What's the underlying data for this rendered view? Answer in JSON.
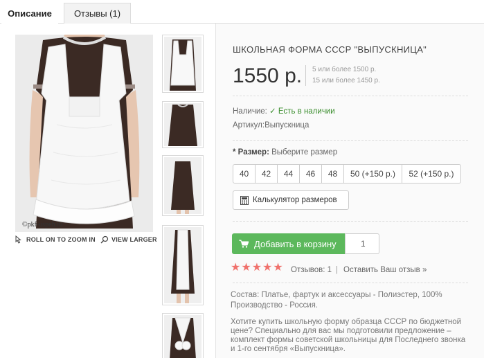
{
  "tabs": [
    {
      "label": "Описание"
    },
    {
      "label": "Отзывы (1)"
    }
  ],
  "gallery": {
    "watermark": "©pkf-uspeh.ru",
    "zoom_hint": "ROLL ON TO ZOOM IN",
    "view_larger": "VIEW LARGER",
    "thumbnail_count": 5
  },
  "product": {
    "title": "ШКОЛЬНАЯ ФОРМА СССР \"ВЫПУСКНИЦА\"",
    "price": "1550 р.",
    "discounts": [
      "5 или более 1500 р.",
      "15 или более 1450 р."
    ],
    "availability_label": "Наличие:",
    "availability_value": "Есть в наличии",
    "sku": "Артикул:Выпускница",
    "size_label": "* Размер:",
    "size_placeholder": "Выберите размер",
    "sizes": [
      "40",
      "42",
      "44",
      "46",
      "48",
      "50 (+150 р.)",
      "52 (+150 р.)"
    ],
    "size_calculator": "Калькулятор размеров",
    "add_to_cart": "Добавить в корзину",
    "quantity": "1",
    "rating": 5,
    "reviews_text": "Отзывов: 1",
    "review_separator": "|",
    "leave_review": "Оставить Ваш отзыв »",
    "composition": "Состав: Платье, фартук и аксессуары - Полиэстер, 100% Производство - Россия.",
    "description": "Хотите купить школьную форму образца СССР по бюджетной цене? Специально для вас мы подготовили предложение – комплект формы советской школьницы для Последнего звонка и 1-го сентября «Выпускница»."
  },
  "colors": {
    "cart_button": "#5cb85c",
    "star": "#f0716c",
    "in_stock": "#3a8d2d",
    "dress": "#3b2a24"
  }
}
